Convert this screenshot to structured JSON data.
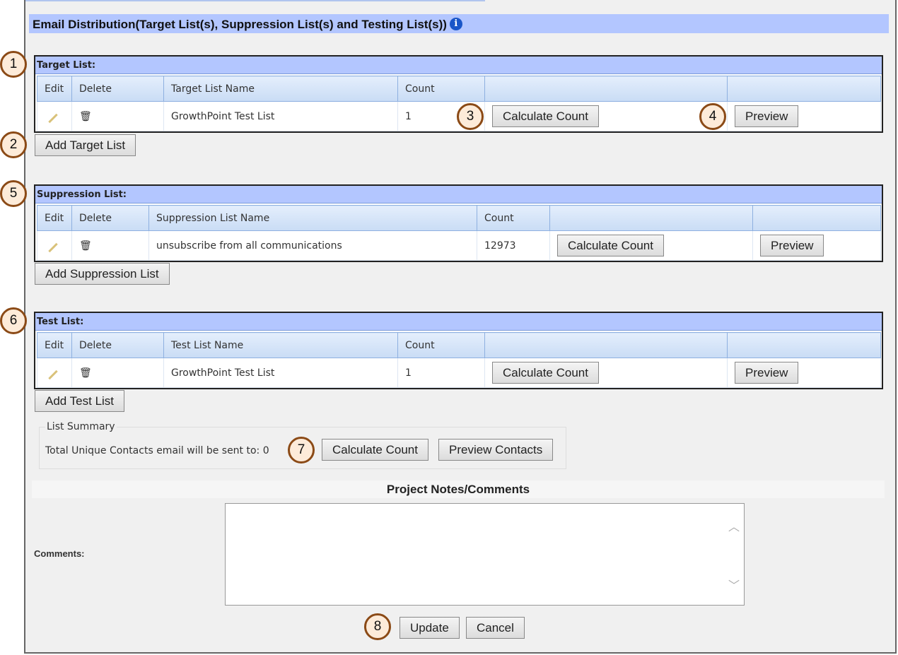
{
  "header": {
    "title": "Email Distribution(Target List(s), Suppression List(s) and Testing List(s))",
    "info_icon": "info-icon"
  },
  "columns": {
    "edit": "Edit",
    "delete": "Delete",
    "count": "Count"
  },
  "buttons": {
    "calculate": "Calculate Count",
    "preview": "Preview",
    "preview_contacts": "Preview Contacts",
    "update": "Update",
    "cancel": "Cancel"
  },
  "target": {
    "title": "Target List:",
    "name_header": "Target List Name",
    "rows": [
      {
        "name": "GrowthPoint Test List",
        "count": "1"
      }
    ],
    "add": "Add Target List"
  },
  "suppression": {
    "title": "Suppression List:",
    "name_header": "Suppression List Name",
    "rows": [
      {
        "name": "unsubscribe from all communications",
        "count": "12973"
      }
    ],
    "add": "Add Suppression List"
  },
  "test": {
    "title": "Test List:",
    "name_header": "Test List Name",
    "rows": [
      {
        "name": "GrowthPoint Test List",
        "count": "1"
      }
    ],
    "add": "Add Test List"
  },
  "summary": {
    "legend": "List Summary",
    "text": "Total Unique Contacts email will be sent to: 0"
  },
  "notes": {
    "heading": "Project Notes/Comments",
    "comments_label": "Comments:",
    "comments_value": ""
  },
  "badges": [
    "1",
    "2",
    "3",
    "4",
    "5",
    "6",
    "7",
    "8"
  ],
  "colors": {
    "header_bg": "#b3c6ff",
    "badge_border": "#8b4a16",
    "badge_fill": "#fdebd9"
  }
}
